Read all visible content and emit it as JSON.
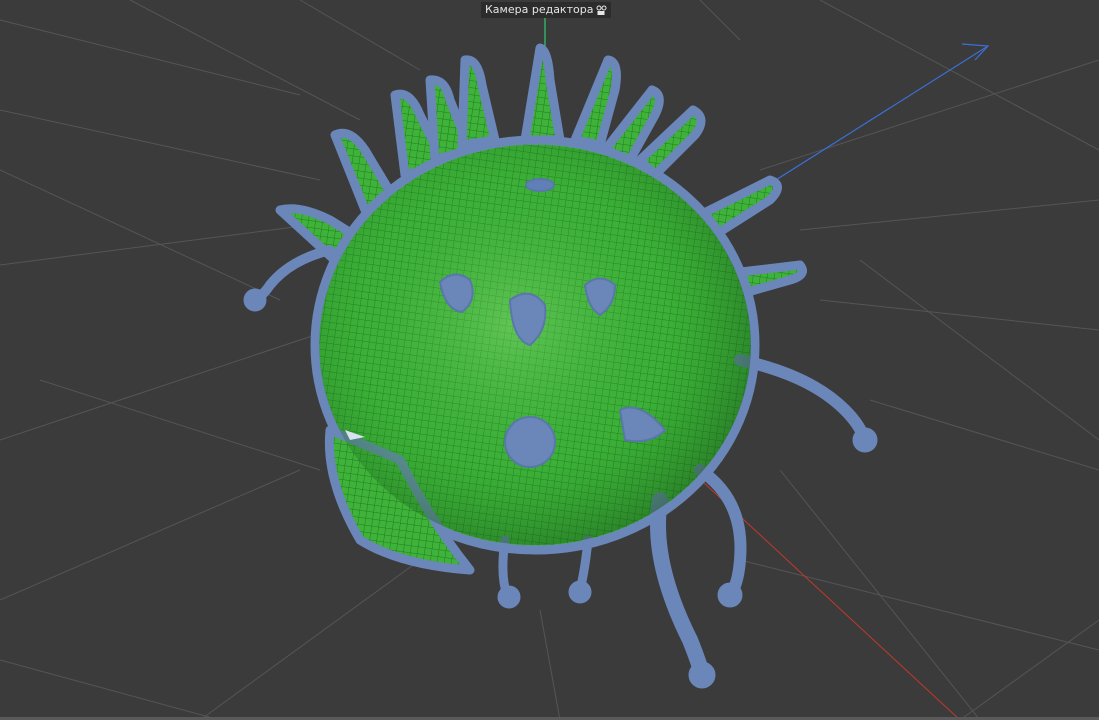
{
  "viewport": {
    "camera_label": "Камера редактора",
    "camera_icon": "camera-icon",
    "background_color": "#3b3b3b",
    "grid_color": "#555555",
    "axis_colors": {
      "x": "#c0392b",
      "y": "#2ecc71",
      "z": "#3b6fd6"
    },
    "object_colors": {
      "mesh_fill": "#6b86b8",
      "wire": "#27c427"
    }
  }
}
